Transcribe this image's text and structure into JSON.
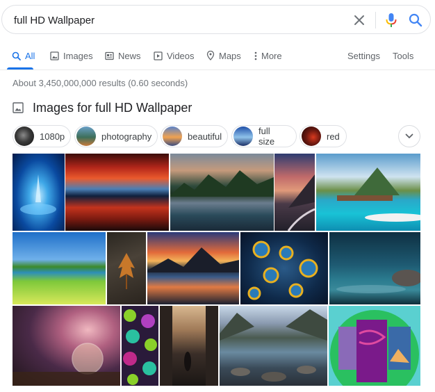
{
  "search": {
    "query": "full HD Wallpaper"
  },
  "icons": {
    "clear": "close-icon",
    "mic": "microphone-icon",
    "search": "search-icon",
    "images_heading": "image-icon",
    "chips_next": "chevron-down-icon"
  },
  "tabs": [
    {
      "label": "All",
      "icon": "search-icon",
      "active": true
    },
    {
      "label": "Images",
      "icon": "image-icon"
    },
    {
      "label": "News",
      "icon": "newspaper-icon"
    },
    {
      "label": "Videos",
      "icon": "play-icon"
    },
    {
      "label": "Maps",
      "icon": "map-pin-icon"
    },
    {
      "label": "More",
      "icon": "vertical-dots-icon"
    }
  ],
  "tools": {
    "settings": "Settings",
    "tools": "Tools"
  },
  "stats": "About 3,450,000,000 results (0.60 seconds)",
  "images_section": {
    "heading": "Images for full HD Wallpaper",
    "chips": [
      {
        "label": "1080p"
      },
      {
        "label": "photography"
      },
      {
        "label": "beautiful"
      },
      {
        "label": "full size"
      },
      {
        "label": "red"
      }
    ]
  },
  "colors": {
    "accent": "#1a73e8",
    "muted_text": "#70757a",
    "tab_text": "#5f6368",
    "mic_blue": "#4285f4",
    "mic_red": "#ea4335",
    "mic_yellow": "#fbbc05",
    "mic_green": "#34a853"
  }
}
